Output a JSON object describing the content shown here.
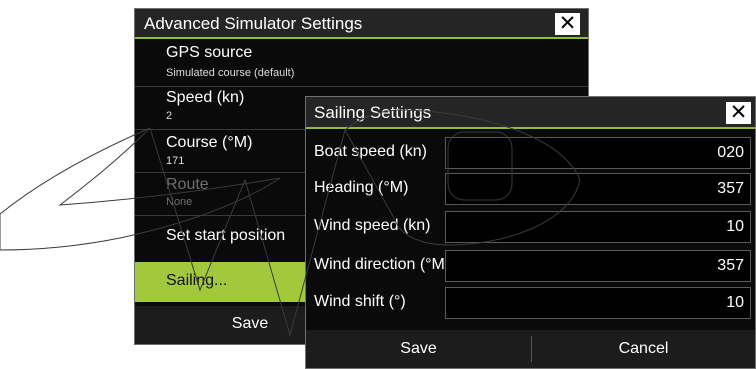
{
  "back_dialog": {
    "title": "Advanced Simulator Settings",
    "close_glyph": "✕",
    "items": [
      {
        "label": "GPS source",
        "value": "Simulated course (default)"
      },
      {
        "label": "Speed (kn)",
        "value": "2"
      },
      {
        "label": "Course (°M)",
        "value": "171"
      },
      {
        "label": "Route",
        "value": "None"
      },
      {
        "label": "Set start position"
      },
      {
        "label": "Sailing..."
      }
    ],
    "save_label": "Save",
    "accent_color": "#a2c83c"
  },
  "front_dialog": {
    "title": "Sailing Settings",
    "close_glyph": "✕",
    "fields": [
      {
        "label": "Boat speed (kn)",
        "value": "020"
      },
      {
        "label": "Heading (°M)",
        "value": "357"
      },
      {
        "label": "Wind speed (kn)",
        "value": "10"
      },
      {
        "label": "Wind direction (°M)",
        "value": "357"
      },
      {
        "label": "Wind shift (°)",
        "value": "10"
      }
    ],
    "save_label": "Save",
    "cancel_label": "Cancel"
  }
}
